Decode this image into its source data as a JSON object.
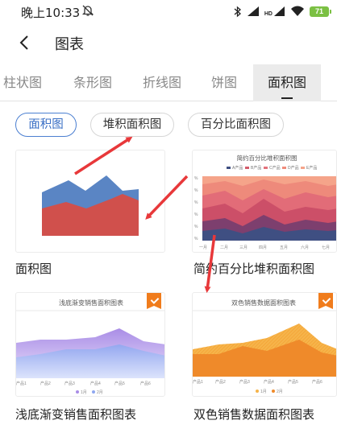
{
  "status_bar": {
    "time": "晚上10:33",
    "battery": "71",
    "network": "HD"
  },
  "header": {
    "title": "图表"
  },
  "tabs": [
    "柱状图",
    "条形图",
    "折线图",
    "饼图",
    "面积图"
  ],
  "chips": [
    "面积图",
    "堆积面积图",
    "百分比面积图"
  ],
  "cards": [
    {
      "label": "面积图"
    },
    {
      "label": "简约百分比堆积面积图",
      "preview_title": "简约百分比堆积面积图",
      "legend": [
        "A产品",
        "B产品",
        "C产品",
        "D产品",
        "E产品"
      ],
      "y_ticks": [
        "%",
        "%",
        "%",
        "%",
        "%",
        "%"
      ],
      "x_ticks": [
        "一月",
        "二月",
        "三月",
        "四月",
        "五月",
        "六月",
        "七月"
      ]
    },
    {
      "label": "浅底渐变销售面积图表",
      "preview_title": "浅底渐变销售面积图表",
      "x_ticks": [
        "产品1",
        "产品2",
        "产品3",
        "产品4",
        "产品5",
        "产品6"
      ],
      "legend": [
        "1月",
        "2月"
      ]
    },
    {
      "label": "双色销售数据面积图表",
      "preview_title": "双色销售数据面积图表",
      "x_ticks": [
        "产品1",
        "产品2",
        "产品3",
        "产品4",
        "产品5",
        "产品6"
      ],
      "legend": [
        "1月",
        "2月"
      ]
    }
  ],
  "colors": {
    "accent": "#4b7fd1",
    "annotation_arrow": "#e8383a",
    "area_blue": "#5a85c4",
    "area_red": "#d0504c",
    "badge": "#f07c1c"
  }
}
